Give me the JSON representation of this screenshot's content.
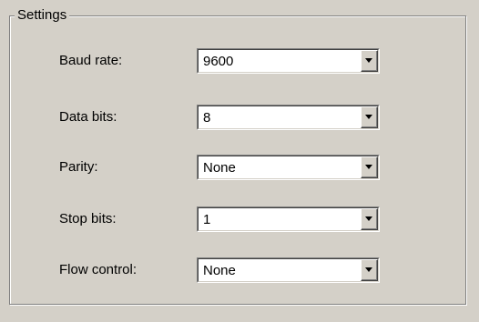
{
  "group": {
    "title": "Settings"
  },
  "fields": [
    {
      "label": "Baud rate:",
      "value": "9600",
      "dropdown_icon": "chevron-down-icon"
    },
    {
      "label": "Data bits:",
      "value": "8",
      "dropdown_icon": "chevron-down-icon"
    },
    {
      "label": "Parity:",
      "value": "None",
      "dropdown_icon": "chevron-down-icon"
    },
    {
      "label": "Stop bits:",
      "value": "1",
      "dropdown_icon": "chevron-down-icon"
    },
    {
      "label": "Flow control:",
      "value": "None",
      "dropdown_icon": "chevron-down-icon"
    }
  ],
  "colors": {
    "dialog_face": "#d4d0c8",
    "field_background": "#ffffff",
    "text": "#000000"
  }
}
